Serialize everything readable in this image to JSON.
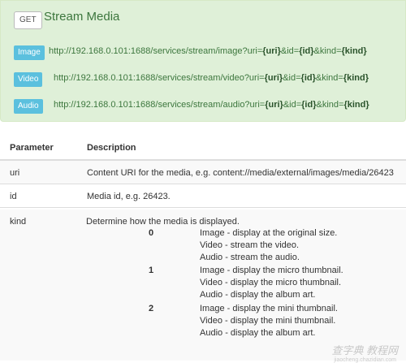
{
  "endpoint": {
    "method": "GET",
    "title": "Stream Media",
    "rows": [
      {
        "label": "Image",
        "url_prefix": "http://192.168.0.101:1688/services/stream/image?uri=",
        "p1": "{uri}",
        "mid1": "&id=",
        "p2": "{id}",
        "mid2": "&kind=",
        "p3": "{kind}"
      },
      {
        "label": "Video",
        "url_prefix": "http://192.168.0.101:1688/services/stream/video?uri=",
        "p1": "{uri}",
        "mid1": "&id=",
        "p2": "{id}",
        "mid2": "&kind=",
        "p3": "{kind}"
      },
      {
        "label": "Audio",
        "url_prefix": "http://192.168.0.101:1688/services/stream/audio?uri=",
        "p1": "{uri}",
        "mid1": "&id=",
        "p2": "{id}",
        "mid2": "&kind=",
        "p3": "{kind}"
      }
    ]
  },
  "table": {
    "headers": {
      "parameter": "Parameter",
      "description": "Description"
    },
    "rows": [
      {
        "param": "uri",
        "desc": "Content URI for the media, e.g. content://media/external/images/media/26423"
      },
      {
        "param": "id",
        "desc": "Media id, e.g. 26423."
      }
    ],
    "kind": {
      "param": "kind",
      "desc": "Determine how the media is displayed.",
      "options": [
        {
          "value": "0",
          "lines": [
            "Image - display at the original size.",
            "Video - stream the video.",
            "Audio - stream the audio."
          ]
        },
        {
          "value": "1",
          "lines": [
            "Image - display the micro thumbnail.",
            "Video - display the micro thumbnail.",
            "Audio - display the album art."
          ]
        },
        {
          "value": "2",
          "lines": [
            "Image - display the mini thumbnail.",
            "Video - display the mini thumbnail.",
            "Audio - display the album art."
          ]
        }
      ]
    }
  },
  "watermark": {
    "main": "查字典 教程网",
    "sub": "jiaocheng.chazidian.com"
  }
}
